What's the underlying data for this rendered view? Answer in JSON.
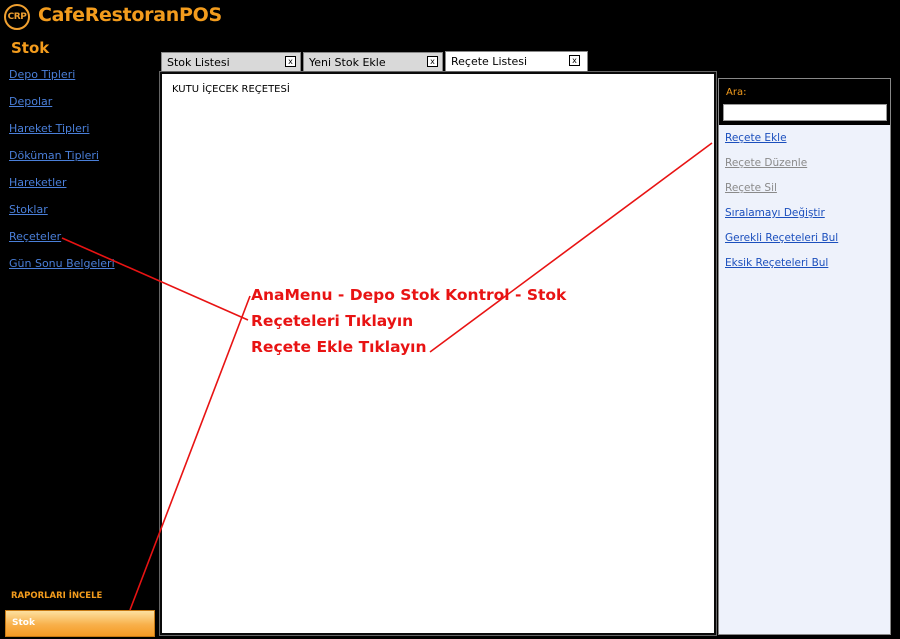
{
  "app": {
    "logo_text": "CRP",
    "title": "CafeRestoranPOS"
  },
  "sidebar": {
    "section_title": "Stok",
    "items": [
      {
        "label": "Depo Tipleri"
      },
      {
        "label": "Depolar"
      },
      {
        "label": "Hareket Tipleri"
      },
      {
        "label": "Döküman Tipleri"
      },
      {
        "label": "Hareketler"
      },
      {
        "label": "Stoklar"
      },
      {
        "label": "Reçeteler"
      },
      {
        "label": "Gün Sonu Belgeleri"
      }
    ],
    "reports_label": "RAPORLARI İNCELE",
    "bottom_button": "Stok"
  },
  "tabs": [
    {
      "label": "Stok Listesi",
      "close": "x",
      "active": false
    },
    {
      "label": "Yeni Stok Ekle",
      "close": "x",
      "active": false
    },
    {
      "label": "Reçete Listesi",
      "close": "x",
      "active": true
    }
  ],
  "main": {
    "recipes": [
      "KUTU İÇECEK REÇETESİ"
    ]
  },
  "right_panel": {
    "search_label": "Ara:",
    "search_value": "",
    "actions": [
      {
        "label": "Reçete Ekle",
        "enabled": true
      },
      {
        "label": "Reçete Düzenle",
        "enabled": false
      },
      {
        "label": "Reçete Sil",
        "enabled": false
      },
      {
        "label": "Sıralamayı Değiştir",
        "enabled": true
      },
      {
        "label": "Gerekli Reçeteleri Bul",
        "enabled": true
      },
      {
        "label": "Eksik Reçeteleri Bul",
        "enabled": true
      }
    ]
  },
  "annotation": {
    "lines": [
      "AnaMenu - Depo Stok Kontrol - Stok",
      "Reçeteleri Tıklayın",
      "Reçete Ekle Tıklayın"
    ],
    "color": "#e81313"
  },
  "colors": {
    "accent": "#f39c1d",
    "link": "#4a7fd9",
    "background": "#000000"
  }
}
